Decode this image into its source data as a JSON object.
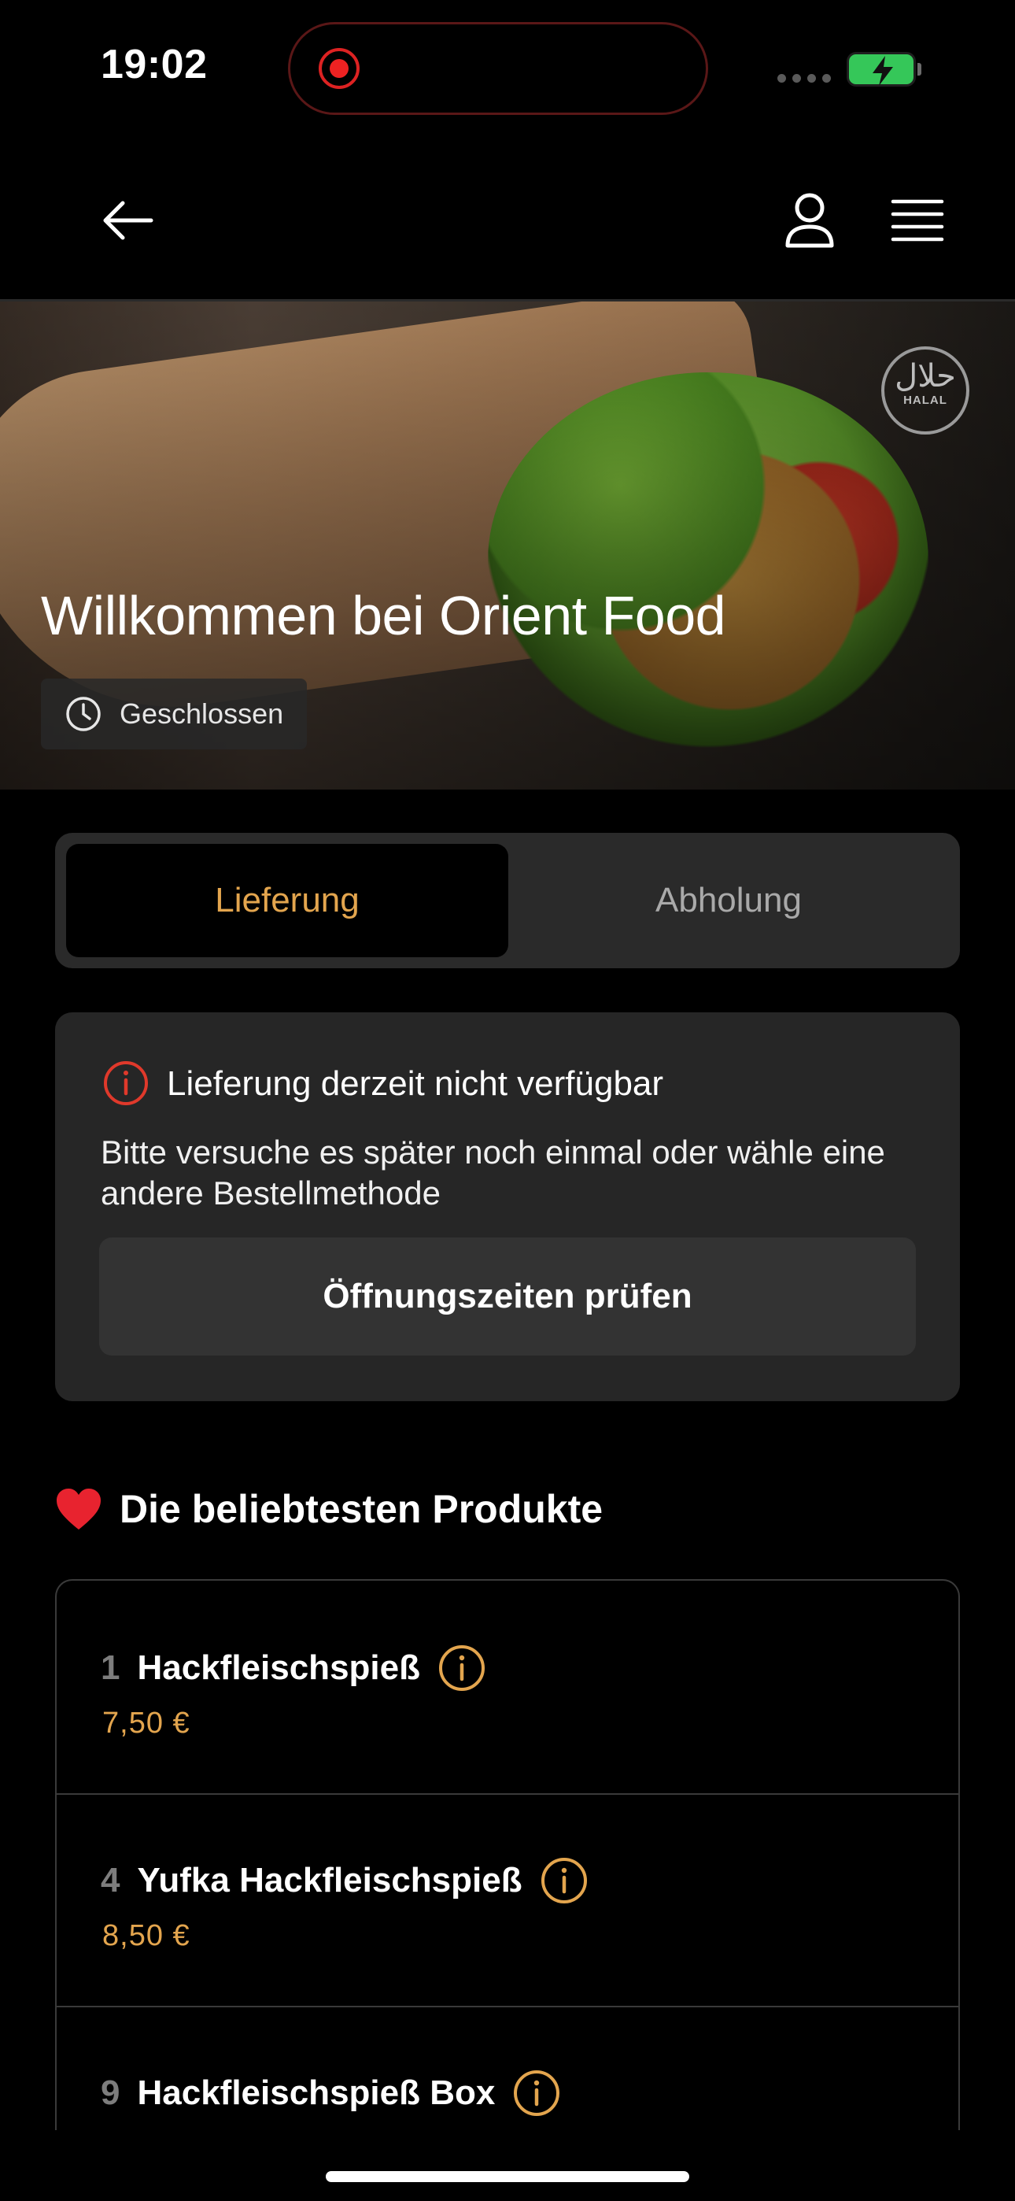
{
  "status_bar": {
    "time": "19:02"
  },
  "hero": {
    "title": "Willkommen bei Orient Food",
    "status": "Geschlossen",
    "halal_ar": "حلال",
    "halal_en": "HALAL"
  },
  "tabs": {
    "active": "Lieferung",
    "inactive": "Abholung"
  },
  "notice": {
    "title": "Lieferung derzeit nicht verfügbar",
    "body": "Bitte versuche es später noch einmal oder wähle eine andere Bestellmethode",
    "button": "Öffnungszeiten prüfen"
  },
  "section": {
    "title": "Die beliebtesten Produkte"
  },
  "products": [
    {
      "number": "1",
      "name": "Hackfleischspieß",
      "price": "7,50 €"
    },
    {
      "number": "4",
      "name": "Yufka Hackfleischspieß",
      "price": "8,50 €"
    },
    {
      "number": "9",
      "name": "Hackfleischspieß Box",
      "price": ""
    }
  ],
  "colors": {
    "accent": "#e3a54e",
    "alert": "#e0392b",
    "card": "#262626"
  }
}
